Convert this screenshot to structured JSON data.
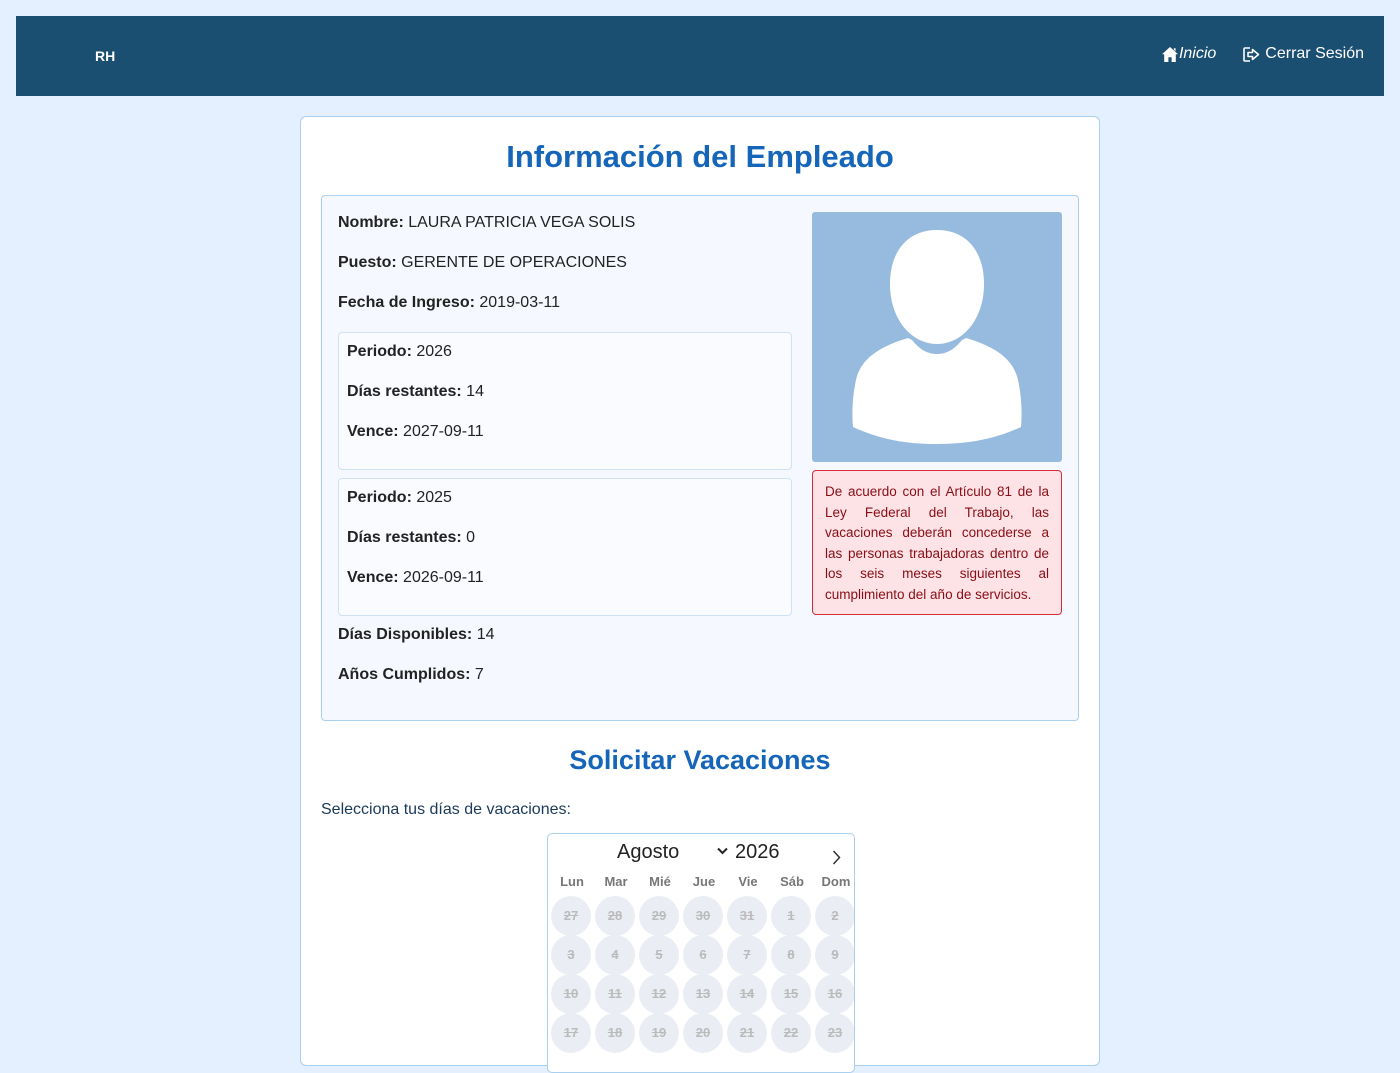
{
  "nav": {
    "brand": "RH",
    "home_label": "Inicio",
    "logout_label": "Cerrar Sesión"
  },
  "page_title": "Información del Empleado",
  "employee": {
    "name_label": "Nombre:",
    "name": "LAURA PATRICIA VEGA SOLIS",
    "position_label": "Puesto:",
    "position": "GERENTE DE OPERACIONES",
    "hire_label": "Fecha de Ingreso:",
    "hire_date": "2019-03-11",
    "periods": [
      {
        "period_label": "Periodo:",
        "period": "2026",
        "remaining_label": "Días restantes:",
        "remaining": "14",
        "expires_label": "Vence:",
        "expires": "2027-09-11"
      },
      {
        "period_label": "Periodo:",
        "period": "2025",
        "remaining_label": "Días restantes:",
        "remaining": "0",
        "expires_label": "Vence:",
        "expires": "2026-09-11"
      }
    ],
    "available_label": "Días Disponibles:",
    "available": "14",
    "years_label": "Años Cumplidos:",
    "years": "7",
    "notice": "De acuerdo con el Artículo 81 de la Ley Federal del Trabajo, las vacaciones deberán concederse a las personas trabajadoras dentro de los seis meses siguientes al cumplimiento del año de servicios."
  },
  "vacation": {
    "title": "Solicitar Vacaciones",
    "select_label": "Selecciona tus días de vacaciones:",
    "calendar": {
      "month": "Agosto",
      "year": "2026",
      "weekdays": [
        "Lun",
        "Mar",
        "Mié",
        "Jue",
        "Vie",
        "Sáb",
        "Dom"
      ],
      "weeks": [
        [
          "27",
          "28",
          "29",
          "30",
          "31",
          "1",
          "2"
        ],
        [
          "3",
          "4",
          "5",
          "6",
          "7",
          "8",
          "9"
        ],
        [
          "10",
          "11",
          "12",
          "13",
          "14",
          "15",
          "16"
        ],
        [
          "17",
          "18",
          "19",
          "20",
          "21",
          "22",
          "23"
        ]
      ]
    }
  },
  "colors": {
    "navbar": "#1b4f72",
    "title": "#1565b8",
    "page_bg": "#e4efff",
    "notice_bg": "#fde3e5",
    "notice_border": "#d92c3a",
    "photo_bg": "#97bbdf"
  }
}
